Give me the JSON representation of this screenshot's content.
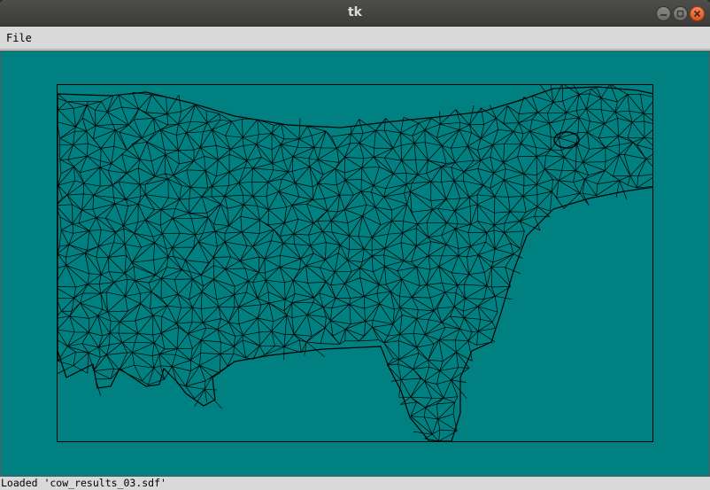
{
  "window": {
    "title": "tk"
  },
  "menubar": {
    "items": [
      {
        "label": "File"
      }
    ]
  },
  "canvas": {
    "background": "#008080",
    "mesh_color": "#000000"
  },
  "status": {
    "text": "Loaded 'cow_results_03.sdf'"
  },
  "icons": {
    "minimize": "minimize-icon",
    "maximize": "maximize-icon",
    "close": "close-icon"
  }
}
